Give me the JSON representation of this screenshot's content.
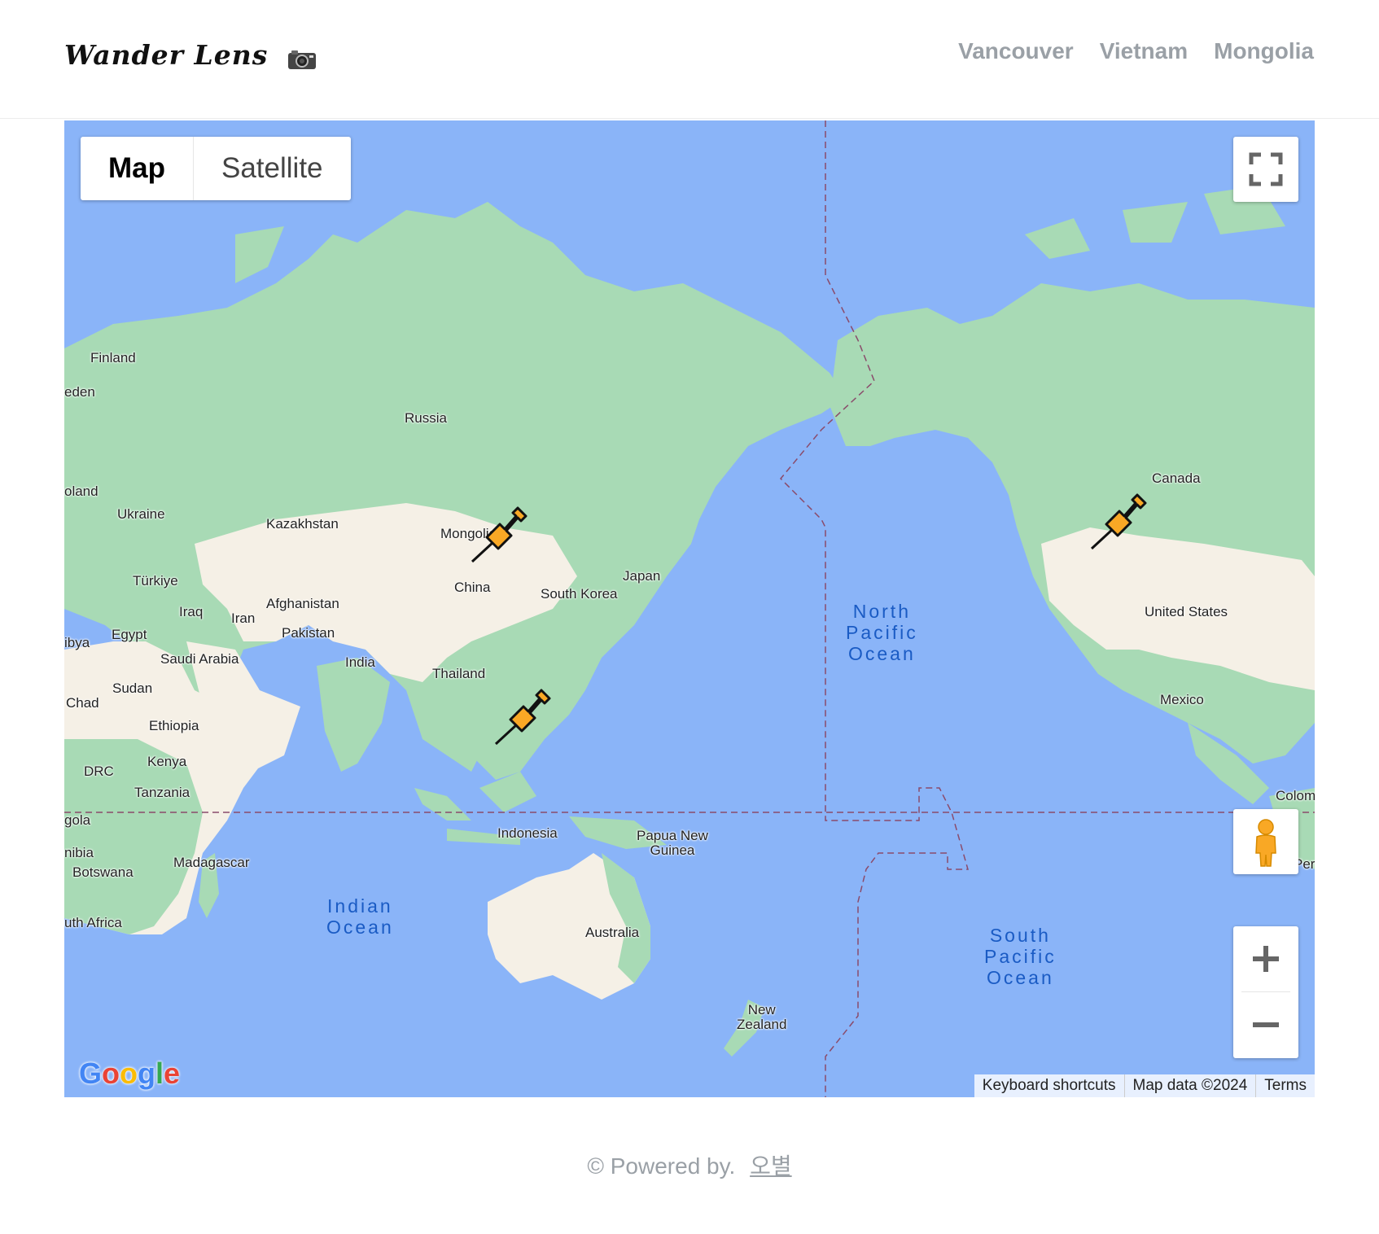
{
  "header": {
    "brand": "Wander Lens",
    "nav": [
      "Vancouver",
      "Vietnam",
      "Mongolia"
    ]
  },
  "map": {
    "type_controls": {
      "map": "Map",
      "satellite": "Satellite",
      "selected": "Map"
    },
    "labels": {
      "finland": "Finland",
      "sweden": "eden",
      "poland": "oland",
      "ukraine": "Ukraine",
      "russia": "Russia",
      "kazakhstan": "Kazakhstan",
      "mongolia": "Mongolia",
      "turkiye": "Türkiye",
      "iraq": "Iraq",
      "iran": "Iran",
      "afghanistan": "Afghanistan",
      "pakistan": "Pakistan",
      "china": "China",
      "japan": "Japan",
      "south_korea": "South Korea",
      "india": "India",
      "thailand": "Thailand",
      "egypt": "Egypt",
      "libya": "ibya",
      "saudi_arabia": "Saudi Arabia",
      "sudan": "Sudan",
      "chad": "Chad",
      "ethiopia": "Ethiopia",
      "kenya": "Kenya",
      "drc": "DRC",
      "tanzania": "Tanzania",
      "angola": "gola",
      "namibia": "nibia",
      "botswana": "Botswana",
      "south_africa": "uth Africa",
      "madagascar": "Madagascar",
      "indonesia": "Indonesia",
      "papua": "Papua New\nGuinea",
      "australia": "Australia",
      "new_zealand": "New\nZealand",
      "canada": "Canada",
      "united_states": "United States",
      "mexico": "Mexico",
      "colombia": "Colom",
      "peru": "Peru"
    },
    "oceans": {
      "north_pacific": "North\nPacific\nOcean",
      "south_pacific": "South\nPacific\nOcean",
      "indian": "Indian\nOcean"
    },
    "pins": [
      "Mongolia",
      "Vietnam",
      "Vancouver"
    ],
    "pin_color": "#f9a825",
    "attribution": [
      "Keyboard shortcuts",
      "Map data ©2024",
      "Terms"
    ],
    "logo": "Google"
  },
  "footer": {
    "powered": "© Powered by.",
    "author": "오별"
  }
}
